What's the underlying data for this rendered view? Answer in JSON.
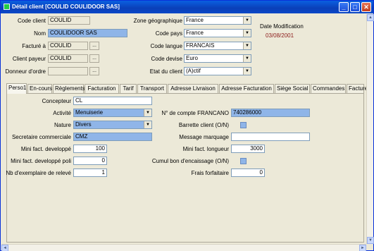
{
  "window": {
    "title": "Détail client [COULID COULIDOOR  SAS]",
    "minimize": "_",
    "maximize": "□",
    "close": "✕"
  },
  "header": {
    "code_client_label": "Code client",
    "code_client_value": "COULID",
    "nom_label": "Nom",
    "nom_value": "COULIDOOR  SAS",
    "facture_label": "Facturé à",
    "facture_value": "COULID",
    "payeur_label": "Client payeur",
    "payeur_value": "COULID",
    "donneur_label": "Donneur d'ordre",
    "donneur_value": "",
    "browse_label": "...",
    "zone_label": "Zone géographique",
    "zone_value": "France",
    "pays_label": "Code pays",
    "pays_value": "France",
    "langue_label": "Code langue",
    "langue_value": "FRANCAIS",
    "devise_label": "Code devise",
    "devise_value": "Euro",
    "etat_label": "Etat du client",
    "etat_value": "(A)ctif",
    "datemod_label": "Date Modification",
    "datemod_value": "03/08/2001"
  },
  "tabs": [
    {
      "label": "Perso1"
    },
    {
      "label": "En-cours"
    },
    {
      "label": "Règlements"
    },
    {
      "label": "Facturation"
    },
    {
      "label": "Tarif"
    },
    {
      "label": "Transport"
    },
    {
      "label": "Adresse Livraison"
    },
    {
      "label": "Adresse Facturation"
    },
    {
      "label": "Siège Social"
    },
    {
      "label": "Commandes"
    },
    {
      "label": "Factures"
    }
  ],
  "perso1": {
    "concepteur_label": "Concepteur",
    "concepteur_value": "CL",
    "activite_label": "Activité",
    "activite_value": "Menuiserie",
    "nature_label": "Nature",
    "nature_value": "Divers",
    "secretaire_label": "Secretaire commerciale",
    "secretaire_value": "CMZ",
    "minidev_label": "Mini fact. developpé",
    "minidev_value": "100",
    "minidevpoli_label": "Mini fact. developpé poli",
    "minidevpoli_value": "0",
    "nbex_label": "Nb d'exemplaire de relevé",
    "nbex_value": "1",
    "compte_label": "N° de compte FRANCANO",
    "compte_value": "740286000",
    "barrette_label": "Barrette client (O/N)",
    "message_label": "Message marquage",
    "message_value": "",
    "minilong_label": "Mini fact. longueur",
    "minilong_value": "3000",
    "cumul_label": "Cumul bon d'encaissage (O/N)",
    "frais_label": "Frais forfaitaire",
    "frais_value": "0"
  },
  "icons": {
    "combo_arrow": "▼",
    "scroll_up": "▲",
    "scroll_down": "▼",
    "scroll_left": "◄",
    "scroll_right": "►"
  }
}
